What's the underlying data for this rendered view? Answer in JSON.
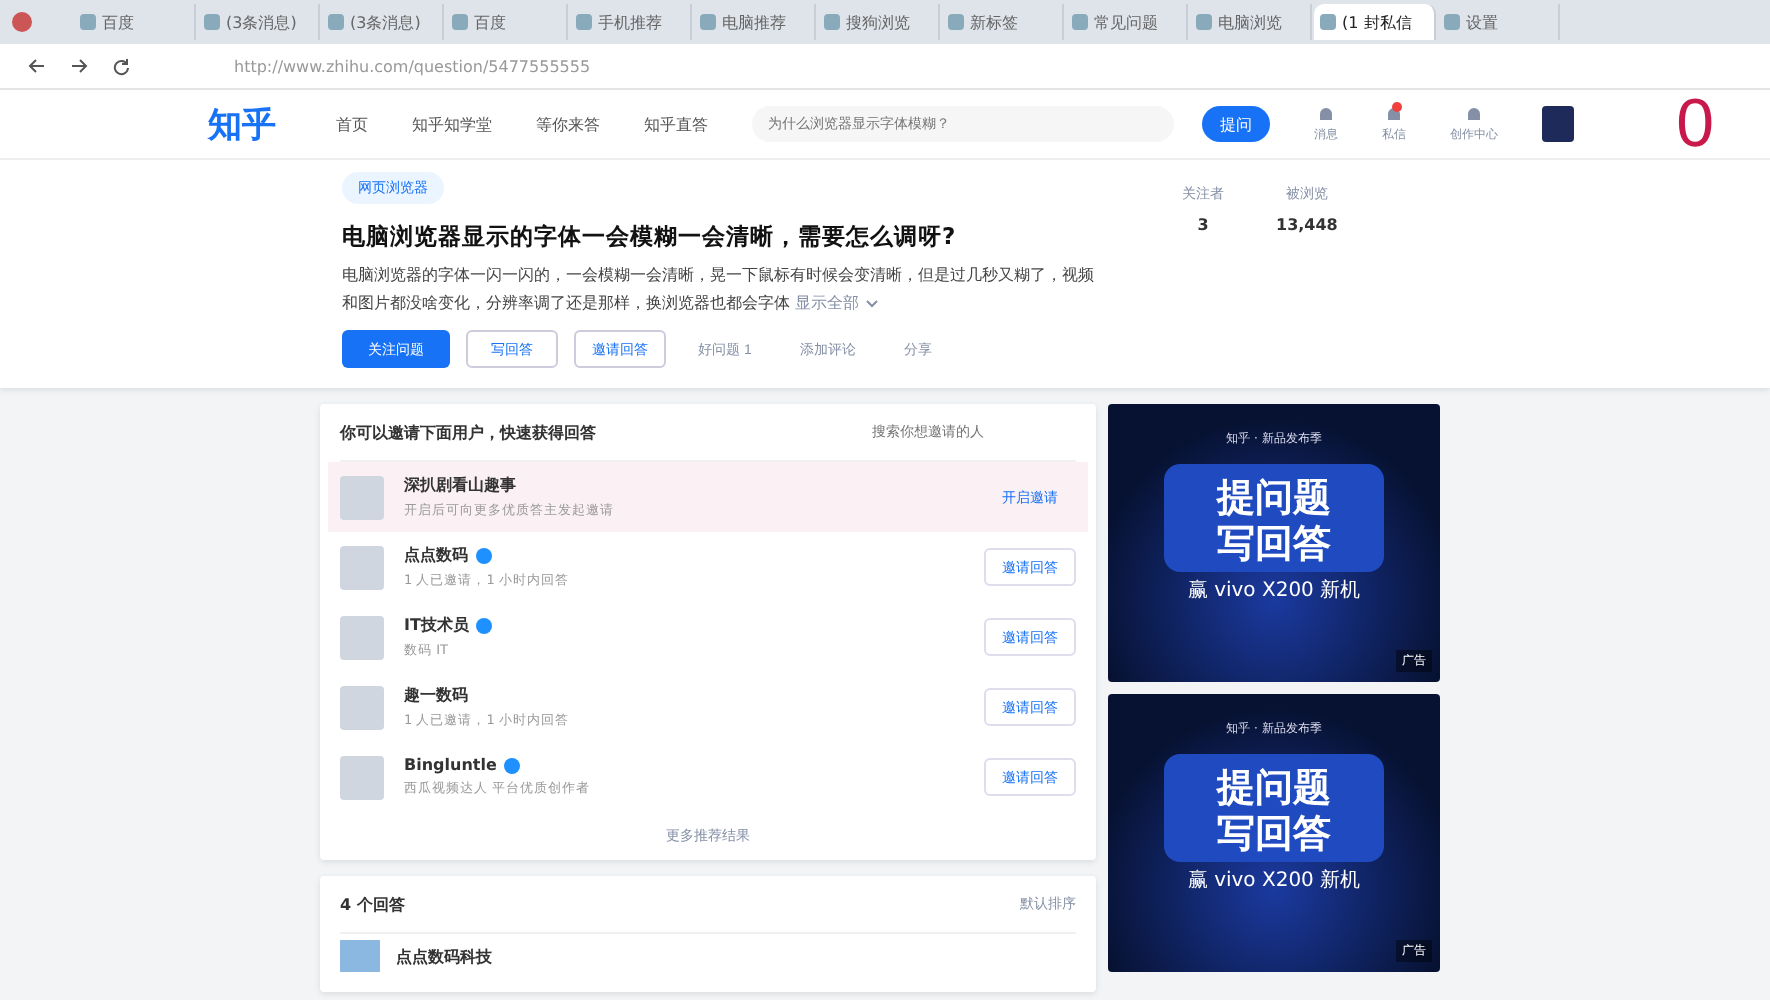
{
  "browser": {
    "tabs": [
      {
        "title": "百度",
        "selected": false
      },
      {
        "title": "(3条消息)",
        "selected": false
      },
      {
        "title": "(3条消息)",
        "selected": false
      },
      {
        "title": "百度",
        "selected": false
      },
      {
        "title": "手机推荐",
        "selected": false
      },
      {
        "title": "电脑推荐",
        "selected": false
      },
      {
        "title": "搜狗浏览",
        "selected": false
      },
      {
        "title": "新标签",
        "selected": false
      },
      {
        "title": "常见问题",
        "selected": false
      },
      {
        "title": "电脑浏览",
        "selected": false
      },
      {
        "title": "(1 封私信",
        "selected": true
      },
      {
        "title": "设置",
        "selected": false
      }
    ],
    "address": "http://www.zhihu.com/question/5477555555"
  },
  "header": {
    "logo": "知乎",
    "nav": [
      {
        "label": "首页",
        "selected": false
      },
      {
        "label": "知乎知学堂",
        "selected": false
      },
      {
        "label": "等你来答",
        "selected": false
      },
      {
        "label": "知乎直答",
        "selected": false
      }
    ],
    "search": {
      "placeholder": "为什么浏览器显示字体模糊？"
    },
    "ask_button": "提问",
    "icons": [
      {
        "label": "消息",
        "badge": false
      },
      {
        "label": "私信",
        "badge": true
      },
      {
        "label": "创作中心",
        "badge": false
      }
    ],
    "counter": "0"
  },
  "question": {
    "topic": "网页浏览器",
    "title": "电脑浏览器显示的字体一会模糊一会清晰，需要怎么调呀?",
    "description": "电脑浏览器的字体一闪一闪的，一会模糊一会清晰，晃一下鼠标有时候会变清晰，但是过几秒又糊了，视频和图片都没啥变化，分辨率调了还是那样，换浏览器也都会字体",
    "show_all": "显示全部",
    "actions": [
      {
        "label": "关注问题",
        "kind": "primary"
      },
      {
        "label": "写回答",
        "kind": "outline"
      },
      {
        "label": "邀请回答",
        "kind": "outline"
      },
      {
        "label": "好问题 1",
        "kind": "plain"
      },
      {
        "label": "添加评论",
        "kind": "plain"
      },
      {
        "label": "分享",
        "kind": "plain"
      }
    ],
    "stats": [
      {
        "label": "关注者",
        "value": "3"
      },
      {
        "label": "被浏览",
        "value": "13,448"
      }
    ]
  },
  "invite": {
    "title": "你可以邀请下面用户，快速获得回答",
    "search": {
      "placeholder": "搜索你想邀请的人"
    },
    "users": [
      {
        "name": "深扒剧看山趣事",
        "bio": "开启后可向更多优质答主发起邀请",
        "verified": false,
        "highlighted": true,
        "action": "开启邀请"
      },
      {
        "name": "点点数码",
        "bio": "1 人已邀请，1 小时内回答",
        "verified": true,
        "highlighted": false,
        "action": "邀请回答"
      },
      {
        "name": "IT技术员",
        "bio": "数码 IT",
        "verified": true,
        "highlighted": false,
        "action": "邀请回答"
      },
      {
        "name": "趣一数码",
        "bio": "1 人已邀请，1 小时内回答",
        "verified": false,
        "highlighted": false,
        "action": "邀请回答"
      },
      {
        "name": "Bingluntle",
        "bio": "西瓜视频达人 平台优质创作者",
        "verified": true,
        "highlighted": false,
        "action": "邀请回答"
      }
    ],
    "more": "更多推荐结果"
  },
  "answers": {
    "count": "4 个回答",
    "sort": "默认排序",
    "first_author": "点点数码科技"
  },
  "ads": [
    {
      "brand": "知乎 · 新品发布季",
      "line1": "提问题",
      "line2": "写回答",
      "prize": "赢 vivo X200 新机",
      "tag": "广告"
    },
    {
      "brand": "知乎 · 新品发布季",
      "line1": "提问题",
      "line2": "写回答",
      "prize": "赢 vivo X200 新机",
      "tag": "广告"
    }
  ]
}
